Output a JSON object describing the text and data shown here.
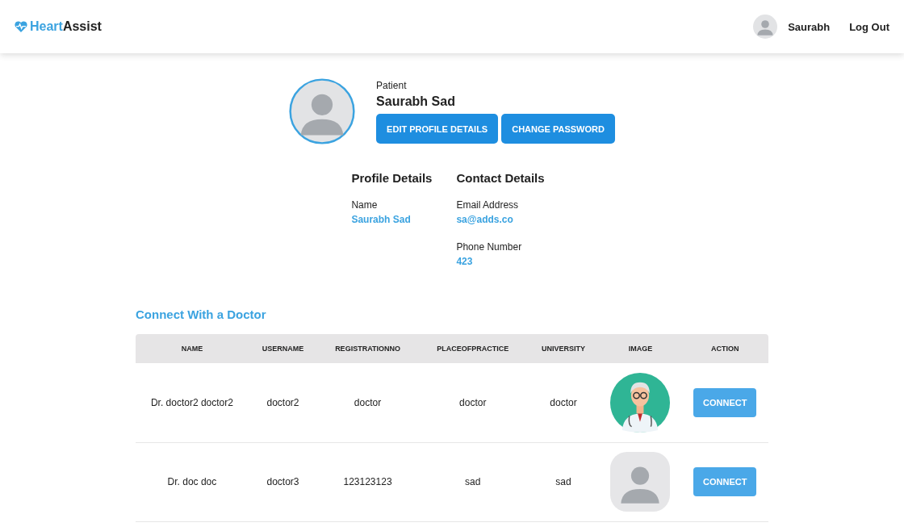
{
  "header": {
    "logo": {
      "first": "Heart",
      "second": "Assist"
    },
    "user": "Saurabh",
    "logout": "Log Out"
  },
  "profile": {
    "role": "Patient",
    "name": "Saurabh Sad",
    "buttons": [
      "EDIT PROFILE DETAILS",
      "CHANGE PASSWORD"
    ]
  },
  "details": [
    {
      "title": "Profile Details",
      "fields": [
        {
          "label": "Name",
          "value": "Saurabh Sad"
        }
      ]
    },
    {
      "title": "Contact Details",
      "fields": [
        {
          "label": "Email Address",
          "value": "sa@adds.co"
        },
        {
          "label": "Phone Number",
          "value": "423"
        }
      ]
    }
  ],
  "doctors": {
    "title": "Connect With a Doctor",
    "columns": [
      "NAME",
      "USERNAME",
      "REGISTRATIONNO",
      "PLACEOFPRACTICE",
      "UNIVERSITY",
      "IMAGE",
      "ACTION"
    ],
    "rows": [
      {
        "cells": [
          "Dr. doctor2 doctor2",
          "doctor2",
          "doctor",
          "doctor",
          "doctor"
        ],
        "kind": "doctor",
        "action": "CONNECT"
      },
      {
        "cells": [
          "Dr. doc doc",
          "doctor3",
          "123123123",
          "sad",
          "sad"
        ],
        "kind": "placeholder",
        "action": "CONNECT"
      }
    ]
  }
}
